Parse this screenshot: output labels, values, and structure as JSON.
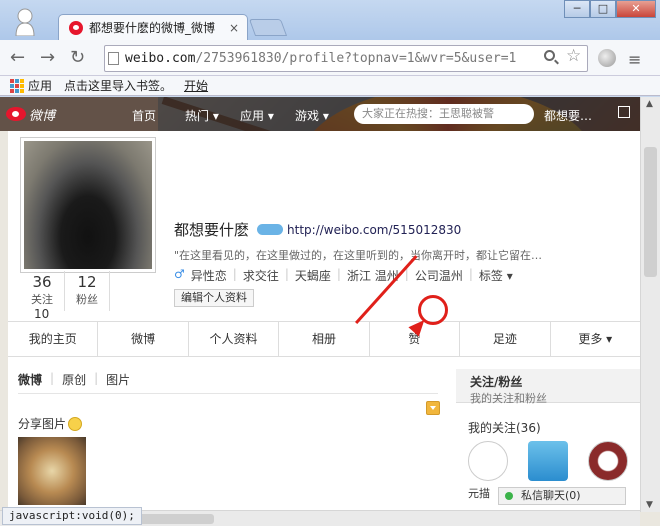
{
  "browser": {
    "tab_title": "都想要什麽的微博_微博",
    "tab_close": "×",
    "url_host": "weibo.com",
    "url_path": "/2753961830/profile?topnav=1&wvr=5&user=1",
    "window_controls": [
      "─",
      "□",
      "✕"
    ],
    "bookmarks": {
      "apps": "应用",
      "import": "点击这里导入书签。",
      "start": "开始"
    },
    "status": "javascript:void(0);"
  },
  "weibo_nav": {
    "logo": "微博",
    "items": [
      "首页",
      "热门 ▾",
      "应用 ▾",
      "游戏 ▾"
    ],
    "search_placeholder": "大家正在热搜：王思聪被警",
    "user": "都想要…"
  },
  "profile": {
    "name": "都想要什麽",
    "url": "http://weibo.com/515012830",
    "intro": "\"在这里看见的，在这里做过的，在这里听到的，当你离开时，都让它留在…",
    "info": [
      "♂",
      "异性恋",
      "求交往",
      "天蝎座",
      "浙江 温州",
      "公司温州",
      "标签 ▾"
    ],
    "edit_button": "编辑个人资料",
    "stats": [
      {
        "num": "36",
        "label": "关注"
      },
      {
        "num": "12",
        "label": "粉丝"
      }
    ],
    "stat_cut": "10"
  },
  "tabs": [
    "我的主页",
    "微博",
    "个人资料",
    "相册",
    "赞",
    "足迹",
    "更多 ▾"
  ],
  "feed": {
    "filters": [
      "微博",
      "原创",
      "图片"
    ],
    "share_text": "分享图片"
  },
  "side": {
    "title": "关注/粉丝",
    "subtitle": "我的关注和粉丝",
    "follow": "我的关注(36)",
    "icon_label": "元描"
  },
  "chat": {
    "label": "私信聊天(0)"
  }
}
